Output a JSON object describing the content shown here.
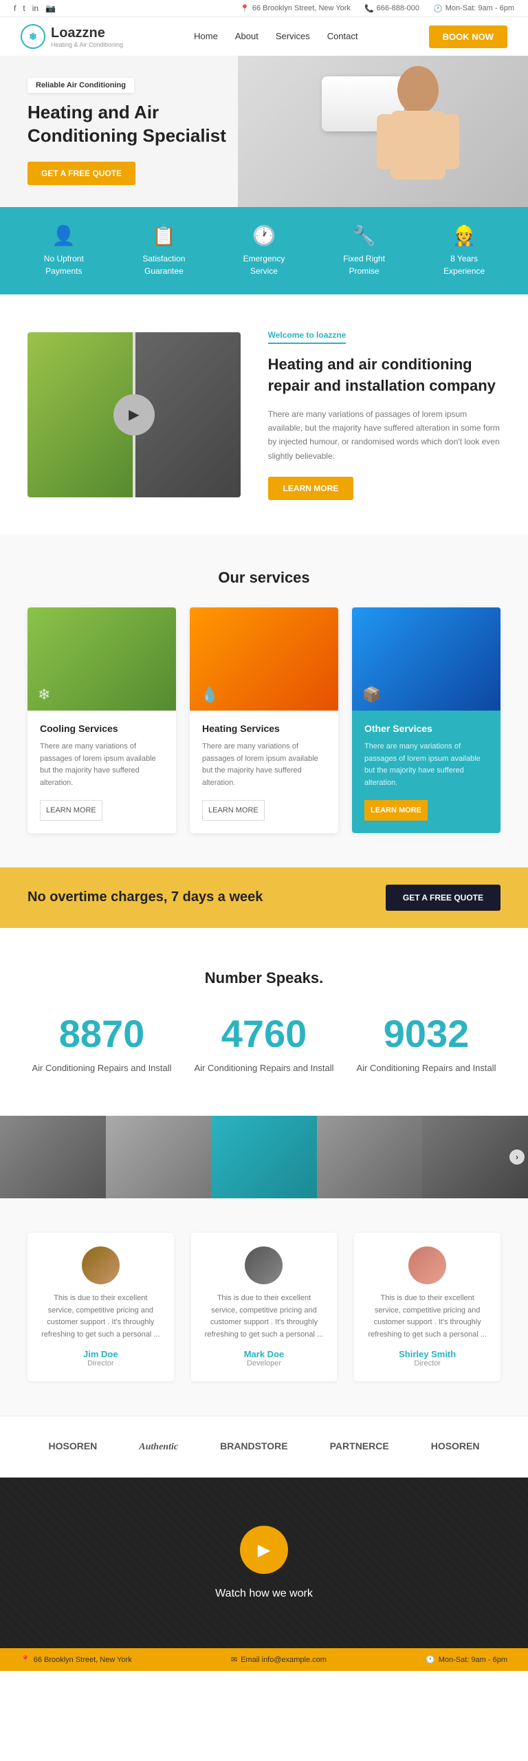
{
  "topbar": {
    "address": "66 Brooklyn Street, New York",
    "phone": "666-888-000",
    "hours": "Mon-Sat: 9am - 6pm",
    "social": [
      "f",
      "t",
      "in",
      "📷"
    ]
  },
  "navbar": {
    "logo_text": "Loazzne",
    "logo_sub": "Heating & Air Conditioning",
    "nav_links": [
      "Home",
      "About",
      "Services",
      "Contact"
    ],
    "book_label": "BOOK NOW"
  },
  "hero": {
    "badge": "Reliable Air Conditioning",
    "title": "Heating and Air Conditioning Specialist",
    "cta_label": "GET A FREE QUOTE"
  },
  "features": [
    {
      "icon": "👤",
      "label": "No Upfront Payments"
    },
    {
      "icon": "📋",
      "label": "Satisfaction Guarantee"
    },
    {
      "icon": "🕐",
      "label": "Emergency Service"
    },
    {
      "icon": "🔧",
      "label": "Fixed Right Promise"
    },
    {
      "icon": "👷",
      "label": "8 Years Experience"
    }
  ],
  "about": {
    "tag": "Welcome to loazzne",
    "title": "Heating and air conditioning repair and installation company",
    "text": "There are many variations of passages of lorem ipsum available, but the majority have suffered alteration in some form by injected humour, or randomised words which don't look even slightly believable.",
    "learn_label": "LEARN MORE"
  },
  "services": {
    "section_title": "Our services",
    "items": [
      {
        "title": "Cooling Services",
        "text": "There are many variations of passages of lorem ipsum available but the majority have suffered alteration.",
        "learn_label": "LEARN MORE",
        "highlight": false
      },
      {
        "title": "Heating Services",
        "text": "There are many variations of passages of lorem ipsum available but the majority have suffered alteration.",
        "learn_label": "LEARN MORE",
        "highlight": false
      },
      {
        "title": "Other Services",
        "text": "There are many variations of passages of lorem ipsum available but the majority have suffered alteration.",
        "learn_label": "LEARN MORE",
        "highlight": true
      }
    ]
  },
  "cta_banner": {
    "text": "No overtime charges, 7 days a week",
    "button_label": "GET A FREE QUOTE"
  },
  "numbers": {
    "title": "Number Speaks.",
    "items": [
      {
        "value": "8870",
        "label": "Air Conditioning Repairs and Install"
      },
      {
        "value": "4760",
        "label": "Air Conditioning Repairs and Install"
      },
      {
        "value": "9032",
        "label": "Air Conditioning Repairs and Install"
      }
    ]
  },
  "testimonials": {
    "items": [
      {
        "text": "This is due to their excellent service, competitive pricing and customer support . It's throughly refreshing to get such a personal ...",
        "name": "Jim Doe",
        "role": "Director"
      },
      {
        "text": "This is due to their excellent service, competitive pricing and customer support . It's throughly refreshing to get such a personal ...",
        "name": "Mark Doe",
        "role": "Developer"
      },
      {
        "text": "This is due to their excellent service, competitive pricing and customer support . It's throughly refreshing to get such a personal ...",
        "name": "Shirley Smith",
        "role": "Director"
      }
    ]
  },
  "partners": [
    {
      "name": "HOSOREN",
      "sub": ""
    },
    {
      "name": "Authentic",
      "sub": ""
    },
    {
      "name": "BRANDSTORE",
      "sub": ""
    },
    {
      "name": "PARTNERCE",
      "sub": ""
    },
    {
      "name": "HOSOREN",
      "sub": ""
    }
  ],
  "video": {
    "label": "Watch how we work"
  },
  "footer": {
    "address": "66 Brooklyn Street, New York",
    "email": "Email info@example.com",
    "hours": "Mon-Sat: 9am - 6pm"
  }
}
